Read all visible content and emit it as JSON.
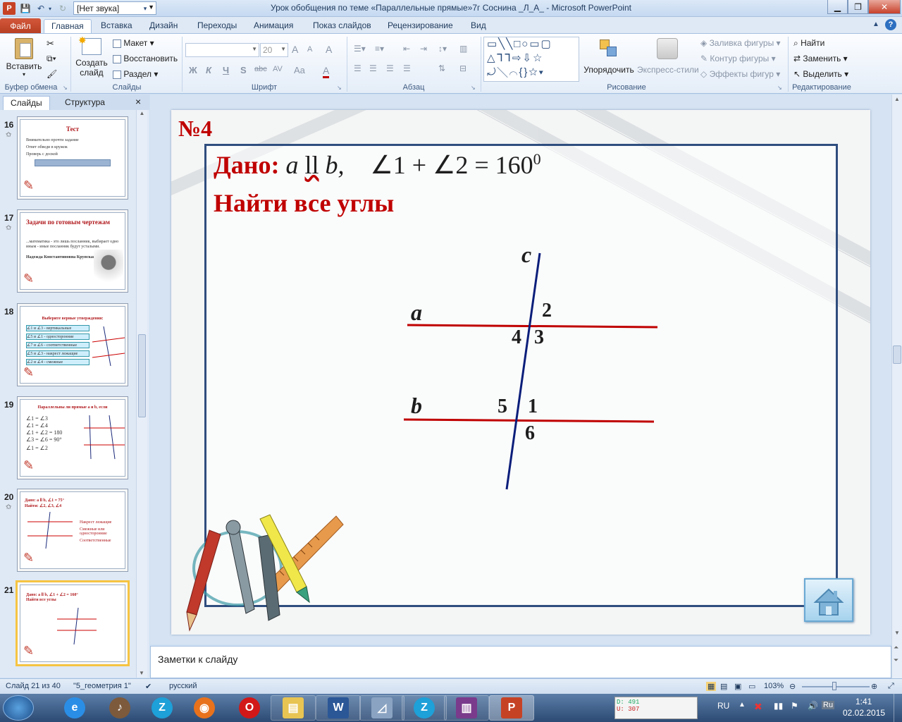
{
  "window": {
    "title": "Урок обобщения по теме «Параллельные прямые»7г Соснина _Л_А_  -  Microsoft PowerPoint",
    "sound_combo": "[Нет звука]"
  },
  "tabs": [
    "Главная",
    "Вставка",
    "Дизайн",
    "Переходы",
    "Анимация",
    "Показ слайдов",
    "Рецензирование",
    "Вид"
  ],
  "file_tab": "Файл",
  "ribbon": {
    "clipboard": {
      "paste": "Вставить",
      "label": "Буфер обмена"
    },
    "slides": {
      "create1": "Создать",
      "create2": "слайд",
      "layout": "Макет",
      "reset": "Восстановить",
      "section": "Раздел",
      "label": "Слайды"
    },
    "font": {
      "size": "20",
      "bold": "Ж",
      "italic": "К",
      "underline": "Ч",
      "shadow": "S",
      "strike": "abc",
      "spacing": "AV",
      "case": "Aa",
      "color": "A",
      "grow": "A",
      "shrink": "A",
      "clear": "A",
      "label": "Шрифт"
    },
    "paragraph": {
      "label": "Абзац"
    },
    "drawing": {
      "arrange": "Упорядочить",
      "quick_styles": "Экспресс-стили",
      "fill": "Заливка фигуры",
      "outline": "Контур фигуры",
      "effects": "Эффекты фигур",
      "label": "Рисование"
    },
    "editing": {
      "find": "Найти",
      "replace": "Заменить",
      "select": "Выделить",
      "label": "Редактирование"
    }
  },
  "left_pane": {
    "tab_slides": "Слайды",
    "tab_outline": "Структура",
    "close": "×",
    "thumbs": [
      {
        "num": "16",
        "title": "Тест",
        "lines": [
          "Внимательно прочти задание",
          "Ответ обведи в кружок",
          "Проверь с доской"
        ]
      },
      {
        "num": "17",
        "title": "Задачи по готовым чертежам",
        "lines": [
          "...математика - это лишь посланник, выбирает одно",
          "иным - иные посланник будут усталыми.",
          "Надежда Константиновна Крупская"
        ]
      },
      {
        "num": "18",
        "title": "Выберите верные утверждения:",
        "lines": [
          "∠1 и ∠3 - вертикальные",
          "∠5 и ∠1 - односторонние",
          "∠7 и ∠6 - соответственные",
          "∠5 и ∠3 - накрест лежащие",
          "∠2 и ∠4 - смежные"
        ]
      },
      {
        "num": "19",
        "title": "Параллельны ли прямые a и b, если",
        "lines": [
          "∠1 = ∠3",
          "∠1 = ∠4",
          "∠1 + ∠2 = 180",
          "∠3 = ∠6 = 90°",
          "∠1 = ∠2"
        ]
      },
      {
        "num": "20",
        "title": "Дано: a ll b, ∠1 = 75°",
        "lines": [
          "Найти: ∠2, ∠3, ∠4",
          "Накрест лежащие",
          "Смежные или односторонние",
          "Соответственные"
        ]
      },
      {
        "num": "21",
        "title": "Дано: a ll b, ∠1 + ∠2 = 160°",
        "lines": [
          "Найти все углы"
        ]
      }
    ]
  },
  "slide": {
    "number_label": "№4",
    "given_label": "Дано:",
    "given_expr_a": "a",
    "given_parallel": "ll",
    "given_expr_b": "b,",
    "given_sum": "∠1 + ∠2 = 160",
    "given_sup": "0",
    "find_label": "Найти все углы",
    "line_c": "c",
    "line_a": "a",
    "line_b": "b",
    "angles": [
      "2",
      "4",
      "3",
      "5",
      "1",
      "6"
    ]
  },
  "notes_placeholder": "Заметки к слайду",
  "status": {
    "slide_count": "Слайд 21 из 40",
    "theme": "\"5_геометрия 1\"",
    "language": "русский",
    "zoom": "103%"
  },
  "taskbar": {
    "lang": "RU",
    "time": "1:41",
    "date": "02.02.2015",
    "net_d": "D: 491",
    "net_u": "U: 307"
  },
  "colors": {
    "accent_red": "#c00000",
    "frame_blue": "#2f4d7e",
    "file_tab": "#c24a2c"
  }
}
